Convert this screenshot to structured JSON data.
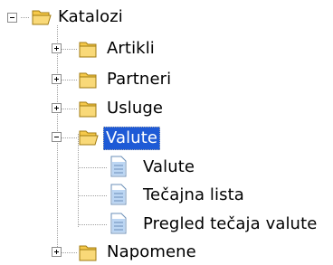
{
  "tree": {
    "root": {
      "label": "Katalozi",
      "expanded": true,
      "icon": "folder-open-icon"
    },
    "children": [
      {
        "label": "Artikli",
        "expanded": false,
        "icon": "folder-icon"
      },
      {
        "label": "Partneri",
        "expanded": false,
        "icon": "folder-icon"
      },
      {
        "label": "Usluge",
        "expanded": false,
        "icon": "folder-icon"
      },
      {
        "label": "Valute",
        "expanded": true,
        "selected": true,
        "icon": "folder-open-icon",
        "children": [
          {
            "label": "Valute",
            "icon": "document-icon"
          },
          {
            "label": "Tečajna lista",
            "icon": "document-icon"
          },
          {
            "label": "Pregled tečaja valute",
            "icon": "document-icon"
          }
        ]
      },
      {
        "label": "Napomene",
        "expanded": false,
        "icon": "folder-icon"
      }
    ],
    "colors": {
      "selection": "#1e5ad6",
      "folder": "#f6c94a",
      "document": "#bcd6f3"
    }
  }
}
